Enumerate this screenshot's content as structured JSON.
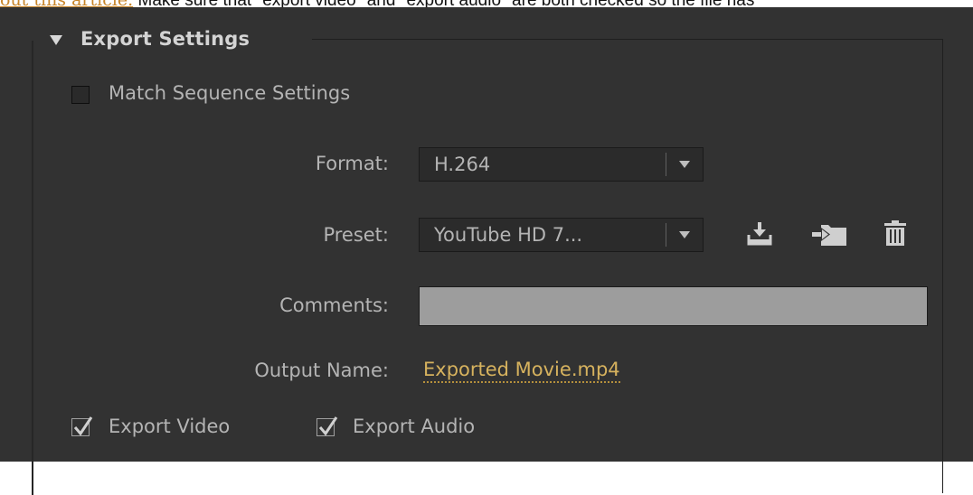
{
  "article": {
    "link_text": "out this article.",
    "text": " Make sure that \"export video\" and \"export audio\" are both checked so the file has"
  },
  "export_settings": {
    "title": "Export Settings",
    "match_sequence": {
      "label": "Match Sequence Settings",
      "checked": false
    },
    "format": {
      "label": "Format:",
      "value": "H.264"
    },
    "preset": {
      "label": "Preset:",
      "value": "YouTube HD 7..."
    },
    "comments": {
      "label": "Comments:",
      "value": ""
    },
    "output_name": {
      "label": "Output Name:",
      "value": "Exported Movie.mp4"
    },
    "export_video": {
      "label": "Export Video",
      "checked": true
    },
    "export_audio": {
      "label": "Export Audio",
      "checked": true
    },
    "preset_icons": [
      "save-preset-icon",
      "import-preset-icon",
      "delete-preset-icon"
    ]
  },
  "colors": {
    "panel_bg": "#323232",
    "text": "#b4b4b4",
    "link": "#d6b25e",
    "input_bg": "#9d9d9d"
  }
}
